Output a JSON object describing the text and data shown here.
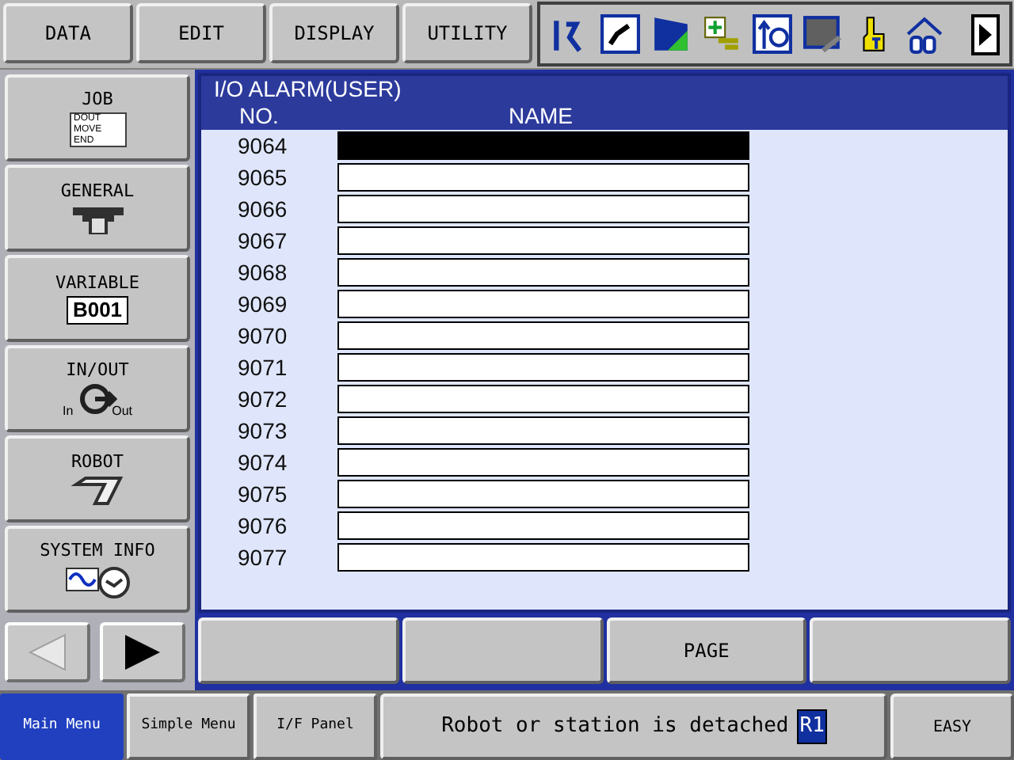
{
  "menu_tabs": [
    "DATA",
    "EDIT",
    "DISPLAY",
    "UTILITY"
  ],
  "side_menu": [
    {
      "label": "JOB",
      "kind": "job",
      "icon_lines": [
        "DOUT",
        "MOVE",
        "END"
      ]
    },
    {
      "label": "GENERAL",
      "kind": "general"
    },
    {
      "label": "VARIABLE",
      "kind": "variable",
      "icon_text": "B001"
    },
    {
      "label": "IN/OUT",
      "kind": "io",
      "icon_lines": [
        "In",
        "Out"
      ]
    },
    {
      "label": "ROBOT",
      "kind": "robot"
    },
    {
      "label": "SYSTEM INFO",
      "kind": "sysinfo"
    }
  ],
  "screen": {
    "title": "I/O ALARM(USER)",
    "columns": [
      "NO.",
      "NAME"
    ],
    "rows": [
      {
        "no": "9064",
        "selected": true
      },
      {
        "no": "9065",
        "selected": false
      },
      {
        "no": "9066",
        "selected": false
      },
      {
        "no": "9067",
        "selected": false
      },
      {
        "no": "9068",
        "selected": false
      },
      {
        "no": "9069",
        "selected": false
      },
      {
        "no": "9070",
        "selected": false
      },
      {
        "no": "9071",
        "selected": false
      },
      {
        "no": "9072",
        "selected": false
      },
      {
        "no": "9073",
        "selected": false
      },
      {
        "no": "9074",
        "selected": false
      },
      {
        "no": "9075",
        "selected": false
      },
      {
        "no": "9076",
        "selected": false
      },
      {
        "no": "9077",
        "selected": false
      }
    ]
  },
  "function_keys": [
    {
      "kind": "blank"
    },
    {
      "kind": "blank"
    },
    {
      "kind": "labeled",
      "label": "PAGE"
    },
    {
      "kind": "blank"
    }
  ],
  "bottom_tabs": [
    {
      "label": "Main Menu",
      "selected": true
    },
    {
      "label": "Simple Menu",
      "selected": false
    },
    {
      "label": "I/F Panel",
      "selected": false
    }
  ],
  "status": {
    "text": "Robot or station is detached",
    "group": "R1"
  },
  "mode_button": "EASY"
}
